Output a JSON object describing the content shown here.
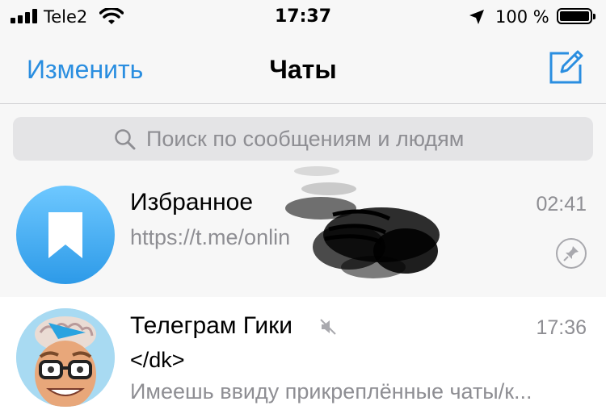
{
  "status_bar": {
    "carrier": "Tele2",
    "time": "17:37",
    "battery_percent": "100 %",
    "battery_level": 1.0,
    "signal_bars": 4
  },
  "nav": {
    "edit_label": "Изменить",
    "title": "Чаты",
    "compose_icon": "compose-icon"
  },
  "search": {
    "placeholder": "Поиск по сообщениям и людям"
  },
  "chats": [
    {
      "name": "Избранное",
      "time": "02:41",
      "preview": "https://t.me/onlin",
      "pinned": true,
      "avatar_icon": "bookmark-icon"
    },
    {
      "name": "Телеграм Гики",
      "time": "17:36",
      "sender": "</dk>",
      "preview": "Имеешь ввиду прикреплённые чаты/к...",
      "muted": true,
      "avatar_icon": "cartoon-avatar"
    }
  ],
  "colors": {
    "accent": "#2a8ee0",
    "secondary_text": "#8e8e93",
    "background": "#f7f7f7"
  }
}
